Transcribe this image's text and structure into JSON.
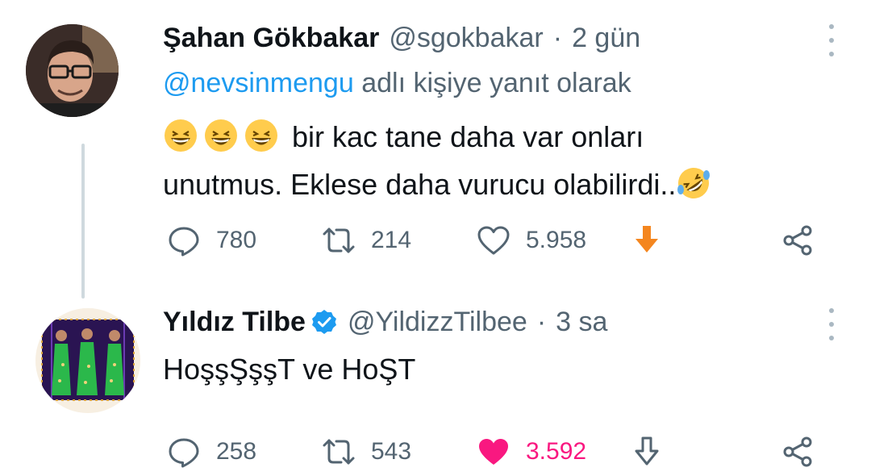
{
  "tweets": [
    {
      "author_name": "Şahan Gökbakar",
      "handle": "@sgokbakar",
      "separator": "·",
      "time": "2 gün",
      "reply_to_user": "@nevsinmengu",
      "reply_to_suffix": "adlı kişiye yanıt olarak",
      "text_line1": "bir kac tane daha var onları",
      "text_line2": "unutmus. Eklese daha vurucu olabilirdi..",
      "leading_emoji": [
        "grinning-squinting-face",
        "grinning-squinting-face",
        "grinning-squinting-face"
      ],
      "trailing_emoji": "rolling-on-floor-laughing",
      "replies": "780",
      "retweets": "214",
      "likes": "5.958",
      "liked": false,
      "extra_action_icon": "orange-down-arrow-icon",
      "verified": false
    },
    {
      "author_name": "Yıldız Tilbe",
      "handle": "@YildizzTilbee",
      "separator": "·",
      "time": "3 sa",
      "text": "HoşşŞşşT ve HoŞT",
      "replies": "258",
      "retweets": "543",
      "likes": "3.592",
      "liked": true,
      "extra_action_icon": "downvote-arrow-icon",
      "verified": true
    }
  ],
  "colors": {
    "name": "#0f1419",
    "meta": "#536471",
    "mention": "#1d9bf0",
    "like_active": "#f91880",
    "verified_badge": "#1d9bf0",
    "extra_arrow": "#f4861f",
    "thread_line": "#cfd9de"
  }
}
